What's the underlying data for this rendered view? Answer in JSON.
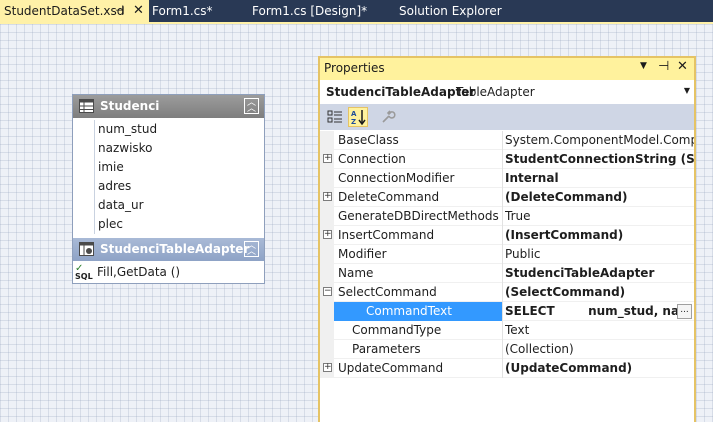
{
  "tabs": [
    {
      "label": "StudentDataSet.xsd",
      "pin": "⊣",
      "close": "✕",
      "active": true
    },
    {
      "label": "Form1.cs*"
    },
    {
      "label": "Form1.cs [Design]*"
    },
    {
      "label": "Solution Explorer"
    }
  ],
  "datatable": {
    "title": "Studenci",
    "columns": [
      "num_stud",
      "nazwisko",
      "imie",
      "adres",
      "data_ur",
      "plec"
    ],
    "adapter_title": "StudenciTableAdapter",
    "method": "Fill,GetData ()",
    "sql_icon_text": "SQL"
  },
  "properties": {
    "title": "Properties",
    "object_name": "StudenciTableAdapter",
    "object_type": "TableAdapter",
    "rows": [
      {
        "name": "BaseClass",
        "value": "System.ComponentModel.Component"
      },
      {
        "name": "Connection",
        "value": "StudentConnectionString (Settings)",
        "expand": "+"
      },
      {
        "name": "ConnectionModifier",
        "value": "Internal"
      },
      {
        "name": "DeleteCommand",
        "value": "(DeleteCommand)",
        "expand": "+"
      },
      {
        "name": "GenerateDBDirectMethods",
        "value": "True"
      },
      {
        "name": "InsertCommand",
        "value": "(InsertCommand)",
        "expand": "+"
      },
      {
        "name": "Modifier",
        "value": "Public"
      },
      {
        "name": "Name",
        "value": "StudenciTableAdapter"
      },
      {
        "name": "SelectCommand",
        "value": "(SelectCommand)",
        "expand": "−"
      },
      {
        "name": "CommandText",
        "value": "SELECT        num_stud, nazwisko",
        "button": "..."
      },
      {
        "name": "CommandType",
        "value": "Text"
      },
      {
        "name": "Parameters",
        "value": "(Collection)"
      },
      {
        "name": "UpdateCommand",
        "value": "(UpdateCommand)",
        "expand": "+"
      }
    ]
  },
  "colors": {
    "tabstrip": "#293955",
    "active_tab": "#fff1a8",
    "selection": "#3399ff",
    "table_header": "#8e8e8e",
    "adapter_header": "#9aadcc"
  }
}
